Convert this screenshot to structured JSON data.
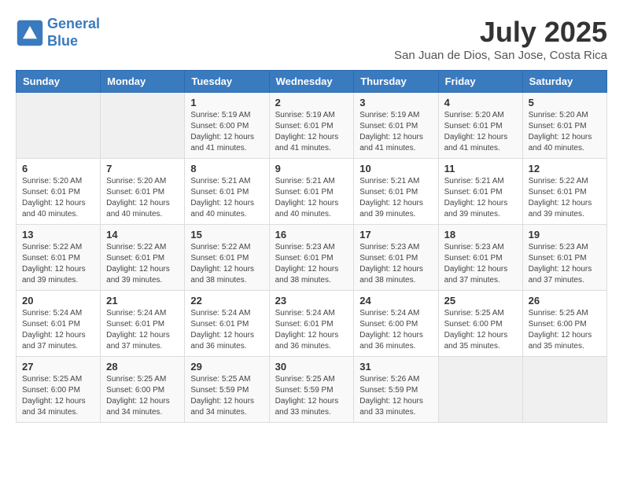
{
  "logo": {
    "line1": "General",
    "line2": "Blue"
  },
  "title": "July 2025",
  "location": "San Juan de Dios, San Jose, Costa Rica",
  "days_of_week": [
    "Sunday",
    "Monday",
    "Tuesday",
    "Wednesday",
    "Thursday",
    "Friday",
    "Saturday"
  ],
  "weeks": [
    [
      {
        "day": "",
        "detail": ""
      },
      {
        "day": "",
        "detail": ""
      },
      {
        "day": "1",
        "detail": "Sunrise: 5:19 AM\nSunset: 6:00 PM\nDaylight: 12 hours\nand 41 minutes."
      },
      {
        "day": "2",
        "detail": "Sunrise: 5:19 AM\nSunset: 6:01 PM\nDaylight: 12 hours\nand 41 minutes."
      },
      {
        "day": "3",
        "detail": "Sunrise: 5:19 AM\nSunset: 6:01 PM\nDaylight: 12 hours\nand 41 minutes."
      },
      {
        "day": "4",
        "detail": "Sunrise: 5:20 AM\nSunset: 6:01 PM\nDaylight: 12 hours\nand 41 minutes."
      },
      {
        "day": "5",
        "detail": "Sunrise: 5:20 AM\nSunset: 6:01 PM\nDaylight: 12 hours\nand 40 minutes."
      }
    ],
    [
      {
        "day": "6",
        "detail": "Sunrise: 5:20 AM\nSunset: 6:01 PM\nDaylight: 12 hours\nand 40 minutes."
      },
      {
        "day": "7",
        "detail": "Sunrise: 5:20 AM\nSunset: 6:01 PM\nDaylight: 12 hours\nand 40 minutes."
      },
      {
        "day": "8",
        "detail": "Sunrise: 5:21 AM\nSunset: 6:01 PM\nDaylight: 12 hours\nand 40 minutes."
      },
      {
        "day": "9",
        "detail": "Sunrise: 5:21 AM\nSunset: 6:01 PM\nDaylight: 12 hours\nand 40 minutes."
      },
      {
        "day": "10",
        "detail": "Sunrise: 5:21 AM\nSunset: 6:01 PM\nDaylight: 12 hours\nand 39 minutes."
      },
      {
        "day": "11",
        "detail": "Sunrise: 5:21 AM\nSunset: 6:01 PM\nDaylight: 12 hours\nand 39 minutes."
      },
      {
        "day": "12",
        "detail": "Sunrise: 5:22 AM\nSunset: 6:01 PM\nDaylight: 12 hours\nand 39 minutes."
      }
    ],
    [
      {
        "day": "13",
        "detail": "Sunrise: 5:22 AM\nSunset: 6:01 PM\nDaylight: 12 hours\nand 39 minutes."
      },
      {
        "day": "14",
        "detail": "Sunrise: 5:22 AM\nSunset: 6:01 PM\nDaylight: 12 hours\nand 39 minutes."
      },
      {
        "day": "15",
        "detail": "Sunrise: 5:22 AM\nSunset: 6:01 PM\nDaylight: 12 hours\nand 38 minutes."
      },
      {
        "day": "16",
        "detail": "Sunrise: 5:23 AM\nSunset: 6:01 PM\nDaylight: 12 hours\nand 38 minutes."
      },
      {
        "day": "17",
        "detail": "Sunrise: 5:23 AM\nSunset: 6:01 PM\nDaylight: 12 hours\nand 38 minutes."
      },
      {
        "day": "18",
        "detail": "Sunrise: 5:23 AM\nSunset: 6:01 PM\nDaylight: 12 hours\nand 37 minutes."
      },
      {
        "day": "19",
        "detail": "Sunrise: 5:23 AM\nSunset: 6:01 PM\nDaylight: 12 hours\nand 37 minutes."
      }
    ],
    [
      {
        "day": "20",
        "detail": "Sunrise: 5:24 AM\nSunset: 6:01 PM\nDaylight: 12 hours\nand 37 minutes."
      },
      {
        "day": "21",
        "detail": "Sunrise: 5:24 AM\nSunset: 6:01 PM\nDaylight: 12 hours\nand 37 minutes."
      },
      {
        "day": "22",
        "detail": "Sunrise: 5:24 AM\nSunset: 6:01 PM\nDaylight: 12 hours\nand 36 minutes."
      },
      {
        "day": "23",
        "detail": "Sunrise: 5:24 AM\nSunset: 6:01 PM\nDaylight: 12 hours\nand 36 minutes."
      },
      {
        "day": "24",
        "detail": "Sunrise: 5:24 AM\nSunset: 6:00 PM\nDaylight: 12 hours\nand 36 minutes."
      },
      {
        "day": "25",
        "detail": "Sunrise: 5:25 AM\nSunset: 6:00 PM\nDaylight: 12 hours\nand 35 minutes."
      },
      {
        "day": "26",
        "detail": "Sunrise: 5:25 AM\nSunset: 6:00 PM\nDaylight: 12 hours\nand 35 minutes."
      }
    ],
    [
      {
        "day": "27",
        "detail": "Sunrise: 5:25 AM\nSunset: 6:00 PM\nDaylight: 12 hours\nand 34 minutes."
      },
      {
        "day": "28",
        "detail": "Sunrise: 5:25 AM\nSunset: 6:00 PM\nDaylight: 12 hours\nand 34 minutes."
      },
      {
        "day": "29",
        "detail": "Sunrise: 5:25 AM\nSunset: 5:59 PM\nDaylight: 12 hours\nand 34 minutes."
      },
      {
        "day": "30",
        "detail": "Sunrise: 5:25 AM\nSunset: 5:59 PM\nDaylight: 12 hours\nand 33 minutes."
      },
      {
        "day": "31",
        "detail": "Sunrise: 5:26 AM\nSunset: 5:59 PM\nDaylight: 12 hours\nand 33 minutes."
      },
      {
        "day": "",
        "detail": ""
      },
      {
        "day": "",
        "detail": ""
      }
    ]
  ]
}
